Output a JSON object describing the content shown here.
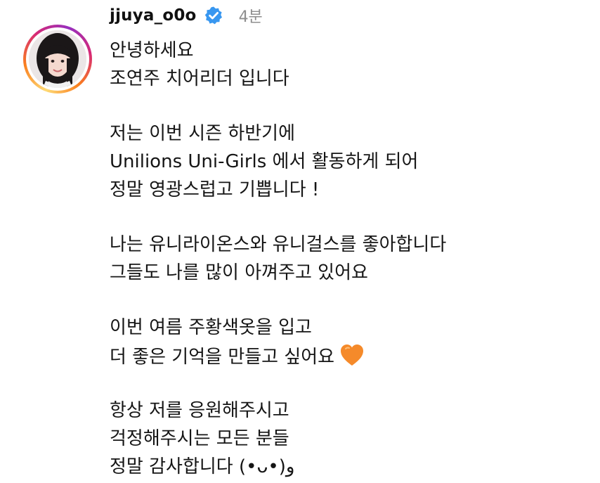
{
  "post": {
    "username": "jjuya_o0o",
    "timestamp": "4분",
    "avatar_icon": "profile-photo",
    "verified_icon": "verified-badge-icon",
    "accent_color": "#3897f0",
    "caption": {
      "p1": [
        "안녕하세요",
        "조연주 치어리더 입니다"
      ],
      "p2": [
        "저는 이번 시즌 하반기에",
        "Unilions Uni-Girls 에서 활동하게 되어",
        "정말 영광스럽고 기쁩니다 !"
      ],
      "p3": [
        "나는 유니라이온스와 유니걸스를 좋아합니다",
        "그들도 나를 많이 아껴주고 있어요"
      ],
      "p4": [
        "이번 여름 주황색옷을 입고",
        "더 좋은 기억을 만들고 싶어요"
      ],
      "p5": [
        "항상 저를 응원해주시고",
        "걱정해주시는 모든 분들",
        "정말 감사합니다 (•ᴗ•)و"
      ],
      "emoji_icon": "orange-heart-icon"
    }
  }
}
